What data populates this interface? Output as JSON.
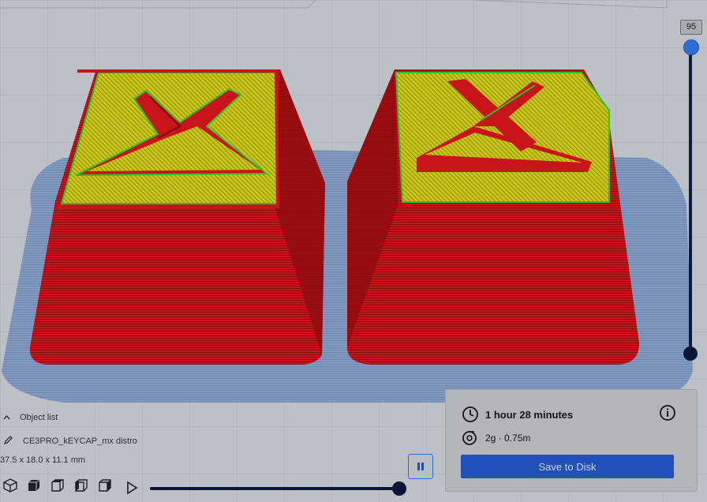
{
  "layer_slider": {
    "current_layer": "95"
  },
  "object_list": {
    "toggle_label": "Object list",
    "object_name": "CE3PRO_kEYCAP_mx distro",
    "dimensions": "37.5 x 18.0 x 11.1 mm"
  },
  "view_buttons": [
    "3d-view-icon",
    "front-view-icon",
    "top-view-icon",
    "left-view-icon",
    "right-view-icon"
  ],
  "simulation": {
    "progress": 1.0
  },
  "print_info": {
    "time": "1 hour 28 minutes",
    "material": "2g · 0.75m",
    "save_label": "Save to Disk"
  },
  "colors": {
    "wall": "#c8141a",
    "top_skin": "#c9c61a",
    "inner_wall": "#2fbf2f",
    "skirt": "#7f98c2",
    "accent": "#2050b8"
  }
}
